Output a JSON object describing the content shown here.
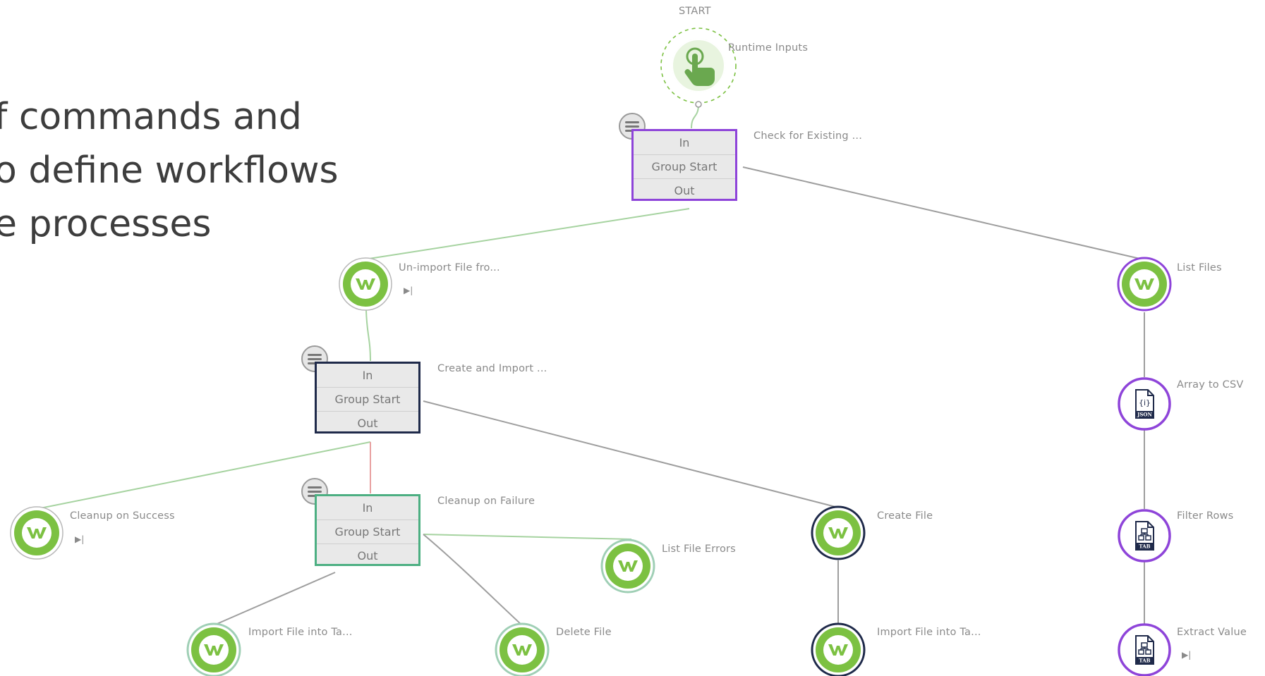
{
  "headline": {
    "lines": [
      "f commands and",
      "o define workflows",
      "e processes"
    ]
  },
  "start_label": "START",
  "colors": {
    "green": "#7cc142",
    "purple": "#8e44d9",
    "navy": "#1f2a4a",
    "teal": "#4caf82",
    "edge_gray": "#9e9e9e",
    "edge_green": "#a6d3a0",
    "edge_red": "#e8a0a0"
  },
  "nodes": {
    "runtime_inputs": {
      "label": "Runtime Inputs",
      "icon": "hand-pointer-icon"
    },
    "check_existing": {
      "label": "Check for Existing ...",
      "rows": [
        "In",
        "Group Start",
        "Out"
      ]
    },
    "unimport_file": {
      "label": "Un-import File fro...",
      "icon": "workiva-w-icon",
      "sub": "▶|"
    },
    "create_import": {
      "label": "Create and Import ...",
      "rows": [
        "In",
        "Group Start",
        "Out"
      ]
    },
    "cleanup_failure": {
      "label": "Cleanup on Failure",
      "rows": [
        "In",
        "Group Start",
        "Out"
      ]
    },
    "cleanup_success": {
      "label": "Cleanup on Success",
      "icon": "workiva-w-icon",
      "sub": "▶|"
    },
    "list_file_errors": {
      "label": "List File Errors",
      "icon": "workiva-w-icon"
    },
    "import_file_1": {
      "label": "Import File into Ta...",
      "icon": "workiva-w-icon"
    },
    "delete_file": {
      "label": "Delete File",
      "icon": "workiva-w-icon"
    },
    "create_file": {
      "label": "Create File",
      "icon": "workiva-w-icon"
    },
    "import_file_2": {
      "label": "Import File into Ta...",
      "icon": "workiva-w-icon"
    },
    "list_files": {
      "label": "List Files",
      "icon": "workiva-w-icon"
    },
    "array_to_csv": {
      "label": "Array to CSV",
      "icon": "json-file-icon",
      "badge": "JSON"
    },
    "filter_rows": {
      "label": "Filter Rows",
      "icon": "tab-file-icon",
      "badge": "TAB"
    },
    "extract_value": {
      "label": "Extract Value",
      "icon": "tab-file-icon",
      "badge": "TAB",
      "sub": "▶|"
    }
  }
}
